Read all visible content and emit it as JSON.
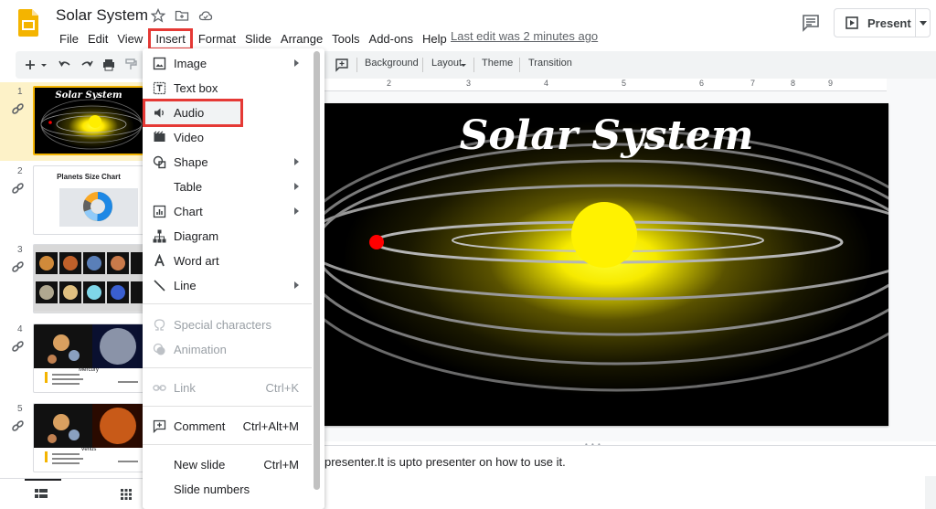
{
  "app": {
    "title": "Solar System",
    "last_edit": "Last edit was 2 minutes ago",
    "present_label": "Present"
  },
  "menubar": [
    "File",
    "Edit",
    "View",
    "Insert",
    "Format",
    "Slide",
    "Arrange",
    "Tools",
    "Add-ons",
    "Help"
  ],
  "toolbar": {
    "background": "Background",
    "layout": "Layout",
    "theme": "Theme",
    "transition": "Transition"
  },
  "ruler": [
    "2",
    "3",
    "4",
    "5",
    "6",
    "7",
    "8",
    "9"
  ],
  "slides": [
    {
      "num": "1",
      "title": "Solar System"
    },
    {
      "num": "2",
      "title": "Planets Size Chart"
    },
    {
      "num": "3",
      "title": ""
    },
    {
      "num": "4",
      "title": "Mercury"
    },
    {
      "num": "5",
      "title": "Venus"
    }
  ],
  "main_slide": {
    "title": "Solar System"
  },
  "notes": "presenter.It is upto presenter on how to use it.",
  "insert_menu": {
    "image": "Image",
    "text_box": "Text box",
    "audio": "Audio",
    "video": "Video",
    "shape": "Shape",
    "table": "Table",
    "chart": "Chart",
    "diagram": "Diagram",
    "word_art": "Word art",
    "line": "Line",
    "special_characters": "Special characters",
    "animation": "Animation",
    "link": "Link",
    "link_shortcut": "Ctrl+K",
    "comment": "Comment",
    "comment_shortcut": "Ctrl+Alt+M",
    "new_slide": "New slide",
    "new_slide_shortcut": "Ctrl+M",
    "slide_numbers": "Slide numbers"
  },
  "colors": {
    "highlight": "#e53935",
    "slides_yellow": "#f4b400",
    "sun": "#ffee00",
    "planet": "#ff0000"
  }
}
